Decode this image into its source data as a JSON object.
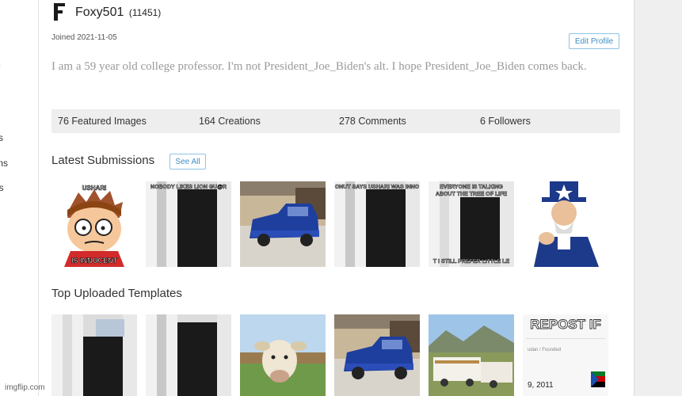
{
  "left_nav": {
    "items": [
      "es",
      "nts",
      "ions",
      "ers"
    ]
  },
  "profile": {
    "logo_letter": "F",
    "username": "Foxy501",
    "points": "(11451)",
    "joined": "Joined 2021-11-05",
    "edit_label": "Edit Profile",
    "bio": "I am a 59 year old college professor. I'm not President_Joe_Biden's alt. I hope President_Joe_Biden comes back."
  },
  "stats": {
    "featured": "76 Featured Images",
    "creations": "164 Creations",
    "comments": "278 Comments",
    "followers": "6 Followers"
  },
  "latest": {
    "title": "Latest Submissions",
    "see_all": "See All",
    "captions": [
      {
        "top": "USHARI",
        "bottom": "IS INNOCENT"
      },
      {
        "top": "NOBODY LIKES LION GU@R",
        "bottom": ""
      },
      {
        "top": "",
        "bottom": ""
      },
      {
        "top": "ONUT SAYS USHARI WAS INNO",
        "bottom": ""
      },
      {
        "top": "EVERYONE IS TALKING ABOUT THE TREE OF LIFE",
        "bottom": "T I STILL PREFER LITTLE LE"
      },
      {
        "top": "",
        "bottom": ""
      }
    ]
  },
  "templates": {
    "title": "Top Uploaded Templates",
    "captions": [
      {
        "top": "",
        "bottom": ""
      },
      {
        "top": "",
        "bottom": ""
      },
      {
        "top": "",
        "bottom": ""
      },
      {
        "top": "",
        "bottom": ""
      },
      {
        "top": "",
        "bottom": ""
      },
      {
        "top": "REPOST IF",
        "bottom": "9, 2011",
        "mid": "udan / Founded"
      }
    ]
  },
  "watermark": "imgflip.com"
}
